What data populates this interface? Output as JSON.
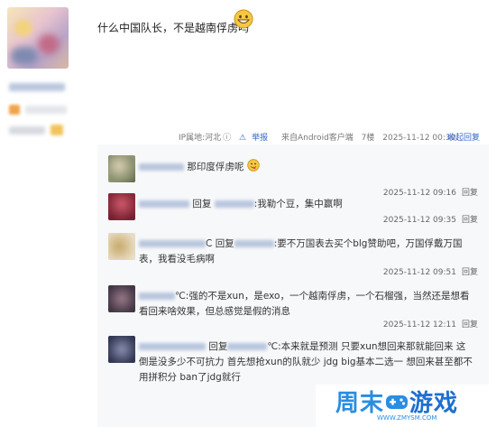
{
  "post": {
    "text": "什么中国队长，不是越南俘虏吗",
    "emoji": "grinning-face"
  },
  "meta": {
    "ip": "IP属地:河北",
    "info_icon": "info-icon",
    "report": "举报",
    "source": "来自Android客户端",
    "floor": "7楼",
    "time": "2025-11-12 00:30",
    "collapse": "收起回复"
  },
  "replies": [
    {
      "text": "那印度俘虏呢",
      "time": "2025-11-12 09:16",
      "reply_label": "回复"
    },
    {
      "prefix": "回复",
      "text": ":我勒个豆，集中赢啊",
      "time": "2025-11-12 09:35",
      "reply_label": "回复"
    },
    {
      "suffix_c": "C",
      "prefix": "回复",
      "text": ":要不万国表去买个blg赞助吧，万国俘戴万国表，我看没毛病啊",
      "time": "2025-11-12 09:51",
      "reply_label": "回复"
    },
    {
      "suffix_c": "℃",
      "text": ":强的不是xun，是exo，一个越南俘虏，一个石榴强，当然还是想看看回来啥效果，但总感觉是假的消息",
      "time": "2025-11-12 12:11",
      "reply_label": "回复"
    },
    {
      "prefix": "回复",
      "suffix_c": "℃",
      "text": ":本来就是预测 只要xun想回来那就能回来 这倒是没多少不可抗力 首先想抢xun的队就少 jdg big基本二选一 想回来甚至都不用拼积分 ban了jdg就行"
    }
  ],
  "watermark": {
    "brand": "周末游戏",
    "brand_a": "周末",
    "brand_b": "游戏",
    "url": "WWW.ZMYSM.COM"
  }
}
